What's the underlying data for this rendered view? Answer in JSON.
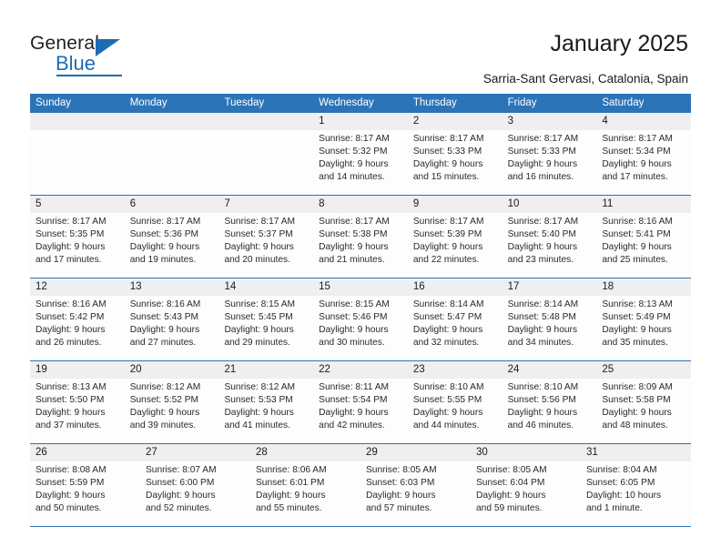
{
  "logo": {
    "word_general": "General",
    "word_blue": "Blue",
    "triangle_color": "#1b6cb5"
  },
  "header": {
    "title": "January 2025",
    "subtitle": "Sarria-Sant Gervasi, Catalonia, Spain",
    "accent_color": "#2b74b8",
    "weekday_text_color": "#ffffff",
    "day_band_color": "#efefef"
  },
  "calendar": {
    "weekdays": [
      "Sunday",
      "Monday",
      "Tuesday",
      "Wednesday",
      "Thursday",
      "Friday",
      "Saturday"
    ],
    "weeks": [
      [
        {
          "day": "",
          "lines": []
        },
        {
          "day": "",
          "lines": []
        },
        {
          "day": "",
          "lines": []
        },
        {
          "day": "1",
          "lines": [
            "Sunrise: 8:17 AM",
            "Sunset: 5:32 PM",
            "Daylight: 9 hours",
            "and 14 minutes."
          ]
        },
        {
          "day": "2",
          "lines": [
            "Sunrise: 8:17 AM",
            "Sunset: 5:33 PM",
            "Daylight: 9 hours",
            "and 15 minutes."
          ]
        },
        {
          "day": "3",
          "lines": [
            "Sunrise: 8:17 AM",
            "Sunset: 5:33 PM",
            "Daylight: 9 hours",
            "and 16 minutes."
          ]
        },
        {
          "day": "4",
          "lines": [
            "Sunrise: 8:17 AM",
            "Sunset: 5:34 PM",
            "Daylight: 9 hours",
            "and 17 minutes."
          ]
        }
      ],
      [
        {
          "day": "5",
          "lines": [
            "Sunrise: 8:17 AM",
            "Sunset: 5:35 PM",
            "Daylight: 9 hours",
            "and 17 minutes."
          ]
        },
        {
          "day": "6",
          "lines": [
            "Sunrise: 8:17 AM",
            "Sunset: 5:36 PM",
            "Daylight: 9 hours",
            "and 19 minutes."
          ]
        },
        {
          "day": "7",
          "lines": [
            "Sunrise: 8:17 AM",
            "Sunset: 5:37 PM",
            "Daylight: 9 hours",
            "and 20 minutes."
          ]
        },
        {
          "day": "8",
          "lines": [
            "Sunrise: 8:17 AM",
            "Sunset: 5:38 PM",
            "Daylight: 9 hours",
            "and 21 minutes."
          ]
        },
        {
          "day": "9",
          "lines": [
            "Sunrise: 8:17 AM",
            "Sunset: 5:39 PM",
            "Daylight: 9 hours",
            "and 22 minutes."
          ]
        },
        {
          "day": "10",
          "lines": [
            "Sunrise: 8:17 AM",
            "Sunset: 5:40 PM",
            "Daylight: 9 hours",
            "and 23 minutes."
          ]
        },
        {
          "day": "11",
          "lines": [
            "Sunrise: 8:16 AM",
            "Sunset: 5:41 PM",
            "Daylight: 9 hours",
            "and 25 minutes."
          ]
        }
      ],
      [
        {
          "day": "12",
          "lines": [
            "Sunrise: 8:16 AM",
            "Sunset: 5:42 PM",
            "Daylight: 9 hours",
            "and 26 minutes."
          ]
        },
        {
          "day": "13",
          "lines": [
            "Sunrise: 8:16 AM",
            "Sunset: 5:43 PM",
            "Daylight: 9 hours",
            "and 27 minutes."
          ]
        },
        {
          "day": "14",
          "lines": [
            "Sunrise: 8:15 AM",
            "Sunset: 5:45 PM",
            "Daylight: 9 hours",
            "and 29 minutes."
          ]
        },
        {
          "day": "15",
          "lines": [
            "Sunrise: 8:15 AM",
            "Sunset: 5:46 PM",
            "Daylight: 9 hours",
            "and 30 minutes."
          ]
        },
        {
          "day": "16",
          "lines": [
            "Sunrise: 8:14 AM",
            "Sunset: 5:47 PM",
            "Daylight: 9 hours",
            "and 32 minutes."
          ]
        },
        {
          "day": "17",
          "lines": [
            "Sunrise: 8:14 AM",
            "Sunset: 5:48 PM",
            "Daylight: 9 hours",
            "and 34 minutes."
          ]
        },
        {
          "day": "18",
          "lines": [
            "Sunrise: 8:13 AM",
            "Sunset: 5:49 PM",
            "Daylight: 9 hours",
            "and 35 minutes."
          ]
        }
      ],
      [
        {
          "day": "19",
          "lines": [
            "Sunrise: 8:13 AM",
            "Sunset: 5:50 PM",
            "Daylight: 9 hours",
            "and 37 minutes."
          ]
        },
        {
          "day": "20",
          "lines": [
            "Sunrise: 8:12 AM",
            "Sunset: 5:52 PM",
            "Daylight: 9 hours",
            "and 39 minutes."
          ]
        },
        {
          "day": "21",
          "lines": [
            "Sunrise: 8:12 AM",
            "Sunset: 5:53 PM",
            "Daylight: 9 hours",
            "and 41 minutes."
          ]
        },
        {
          "day": "22",
          "lines": [
            "Sunrise: 8:11 AM",
            "Sunset: 5:54 PM",
            "Daylight: 9 hours",
            "and 42 minutes."
          ]
        },
        {
          "day": "23",
          "lines": [
            "Sunrise: 8:10 AM",
            "Sunset: 5:55 PM",
            "Daylight: 9 hours",
            "and 44 minutes."
          ]
        },
        {
          "day": "24",
          "lines": [
            "Sunrise: 8:10 AM",
            "Sunset: 5:56 PM",
            "Daylight: 9 hours",
            "and 46 minutes."
          ]
        },
        {
          "day": "25",
          "lines": [
            "Sunrise: 8:09 AM",
            "Sunset: 5:58 PM",
            "Daylight: 9 hours",
            "and 48 minutes."
          ]
        }
      ],
      [
        {
          "day": "26",
          "lines": [
            "Sunrise: 8:08 AM",
            "Sunset: 5:59 PM",
            "Daylight: 9 hours",
            "and 50 minutes."
          ]
        },
        {
          "day": "27",
          "lines": [
            "Sunrise: 8:07 AM",
            "Sunset: 6:00 PM",
            "Daylight: 9 hours",
            "and 52 minutes."
          ]
        },
        {
          "day": "28",
          "lines": [
            "Sunrise: 8:06 AM",
            "Sunset: 6:01 PM",
            "Daylight: 9 hours",
            "and 55 minutes."
          ]
        },
        {
          "day": "29",
          "lines": [
            "Sunrise: 8:05 AM",
            "Sunset: 6:03 PM",
            "Daylight: 9 hours",
            "and 57 minutes."
          ]
        },
        {
          "day": "30",
          "lines": [
            "Sunrise: 8:05 AM",
            "Sunset: 6:04 PM",
            "Daylight: 9 hours",
            "and 59 minutes."
          ]
        },
        {
          "day": "31",
          "lines": [
            "Sunrise: 8:04 AM",
            "Sunset: 6:05 PM",
            "Daylight: 10 hours",
            "and 1 minute."
          ]
        }
      ]
    ]
  }
}
